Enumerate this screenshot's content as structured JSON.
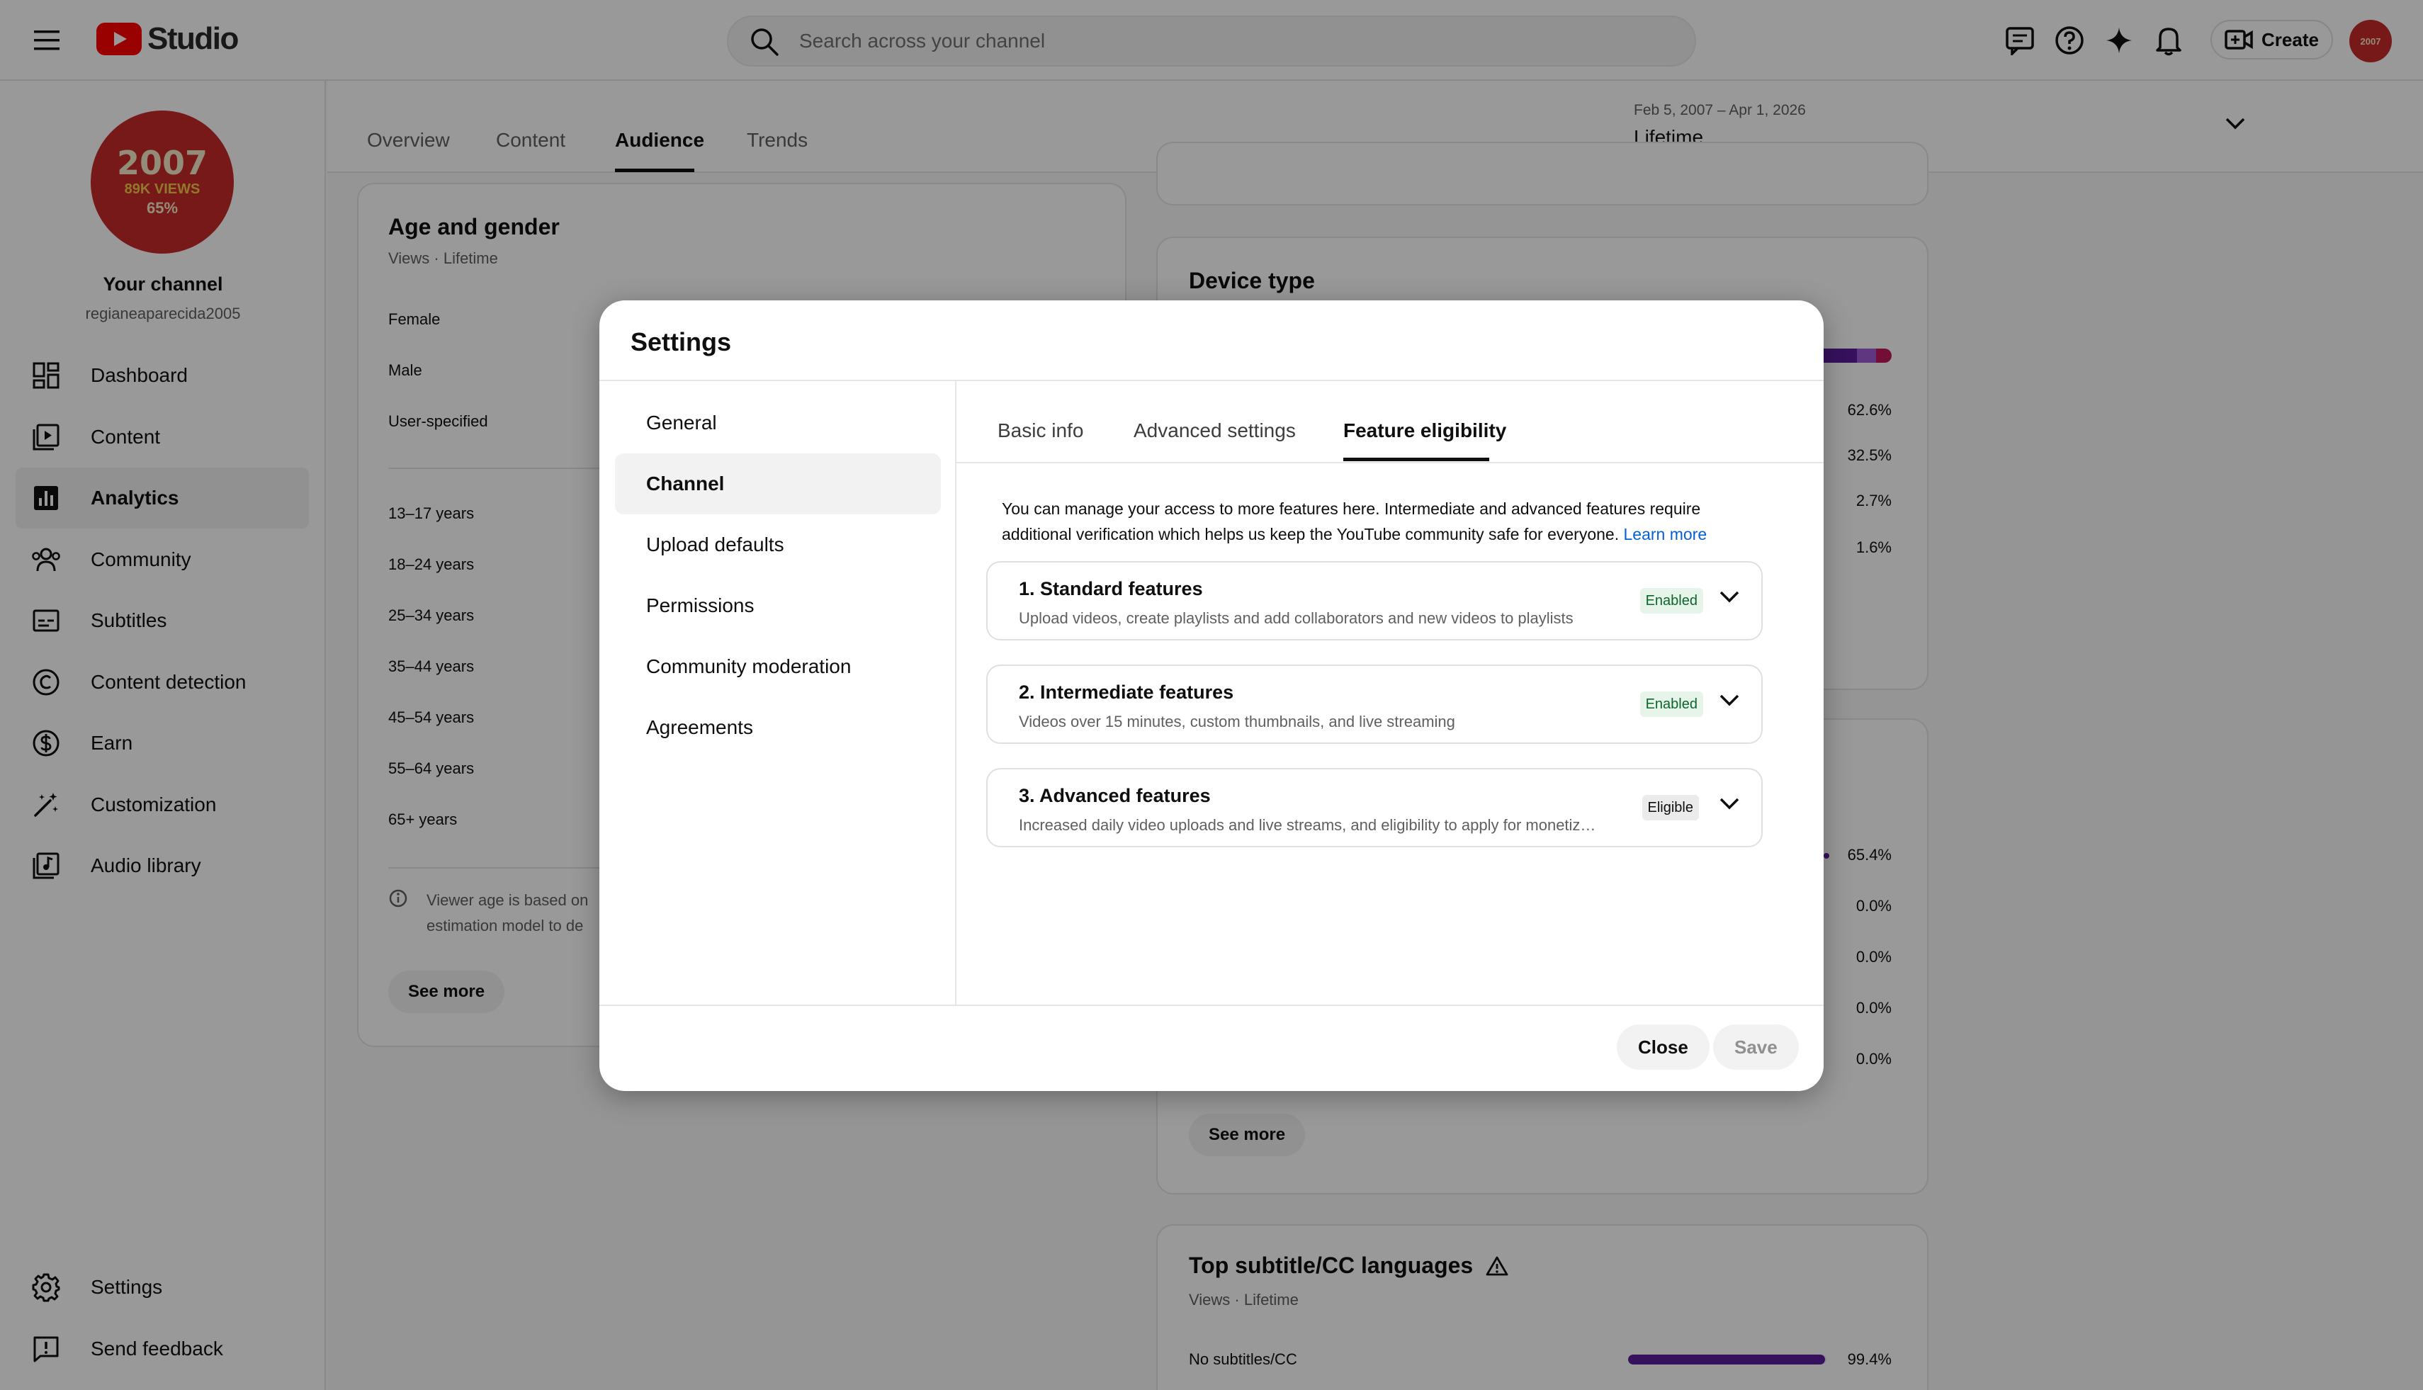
{
  "header": {
    "app_name": "Studio",
    "search_placeholder": "Search across your channel",
    "create_label": "Create"
  },
  "channel": {
    "avatar_text_top": "2007",
    "avatar_text_mid": "89K VIEWS",
    "avatar_text_bottom": "65%",
    "label": "Your channel",
    "handle": "regianeaparecida2005"
  },
  "sidebar": {
    "items": [
      {
        "label": "Dashboard",
        "icon": "dashboard-icon"
      },
      {
        "label": "Content",
        "icon": "content-icon"
      },
      {
        "label": "Analytics",
        "icon": "analytics-icon"
      },
      {
        "label": "Community",
        "icon": "community-icon"
      },
      {
        "label": "Subtitles",
        "icon": "subtitles-icon"
      },
      {
        "label": "Content detection",
        "icon": "copyright-icon"
      },
      {
        "label": "Earn",
        "icon": "dollar-icon"
      },
      {
        "label": "Customization",
        "icon": "magic-wand-icon"
      },
      {
        "label": "Audio library",
        "icon": "audio-library-icon"
      }
    ],
    "footer": [
      {
        "label": "Settings",
        "icon": "gear-icon"
      },
      {
        "label": "Send feedback",
        "icon": "feedback-icon"
      }
    ]
  },
  "analytics": {
    "tabs": [
      "Overview",
      "Content",
      "Audience",
      "Trends"
    ],
    "active_tab": "Audience",
    "date_range": "Feb 5, 2007 – Apr 1, 2026",
    "date_preset": "Lifetime"
  },
  "age_gender": {
    "title": "Age and gender",
    "subtitle": "Views · Lifetime",
    "genders": [
      "Female",
      "Male",
      "User-specified"
    ],
    "ages": [
      "13–17 years",
      "18–24 years",
      "25–34 years",
      "35–44 years",
      "45–54 years",
      "55–64 years",
      "65+ years"
    ],
    "note_line1": "Viewer age is based on",
    "note_line2": "estimation model to de",
    "see_more": "See more"
  },
  "device_type": {
    "title": "Device type",
    "percents": [
      "62.6%",
      "32.5%",
      "2.7%",
      "1.6%"
    ]
  },
  "second_card": {
    "percents": [
      "65.4%",
      "0.0%",
      "0.0%",
      "0.0%",
      "0.0%"
    ],
    "see_more": "See more"
  },
  "subtitle_card": {
    "title": "Top subtitle/CC languages",
    "subtitle": "Views · Lifetime",
    "row_label": "No subtitles/CC",
    "row_value": 99.4,
    "row_percent": "99.4%"
  },
  "colors": {
    "accent_purple": "#5a1d9b",
    "youtube_red": "#ff0000",
    "link_blue": "#065fd4"
  },
  "settings_modal": {
    "title": "Settings",
    "nav": [
      "General",
      "Channel",
      "Upload defaults",
      "Permissions",
      "Community moderation",
      "Agreements"
    ],
    "active_nav": "Channel",
    "tabs": [
      "Basic info",
      "Advanced settings",
      "Feature eligibility"
    ],
    "active_tab": "Feature eligibility",
    "intro_line1": "You can manage your access to more features here. Intermediate and advanced features require",
    "intro_line2": "additional verification which helps us keep the YouTube community safe for everyone.",
    "learn_more": "Learn more",
    "features": [
      {
        "title": "1. Standard features",
        "desc": "Upload videos, create playlists and add collaborators and new videos to playlists",
        "status": "Enabled"
      },
      {
        "title": "2. Intermediate features",
        "desc": "Videos over 15 minutes, custom thumbnails, and live streaming",
        "status": "Enabled"
      },
      {
        "title": "3. Advanced features",
        "desc": "Increased daily video uploads and live streams, and eligibility to apply for monetiz…",
        "status": "Eligible"
      }
    ],
    "close_label": "Close",
    "save_label": "Save"
  }
}
